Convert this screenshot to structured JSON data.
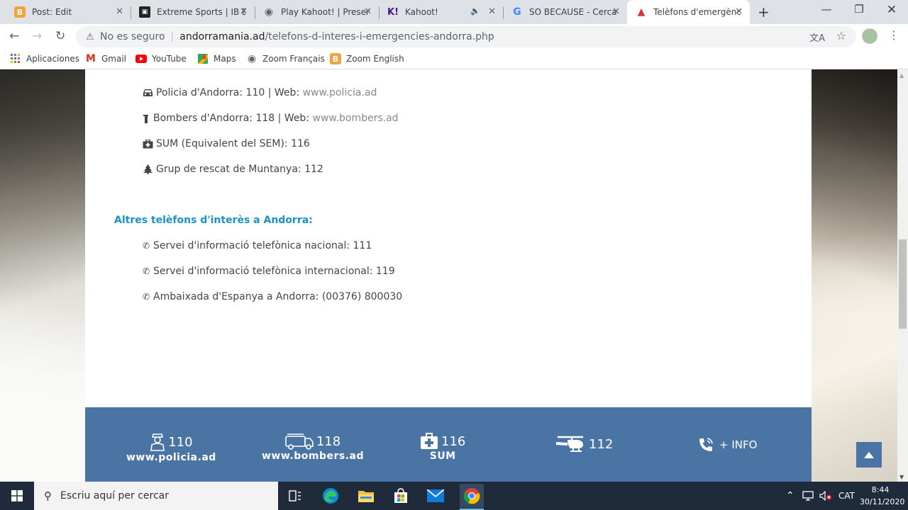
{
  "browser": {
    "tabs": [
      {
        "label": "Post: Edit",
        "favicon": "blogger-icon",
        "active": false
      },
      {
        "label": "Extreme Sports | IB E",
        "favicon": "ib-icon",
        "active": false
      },
      {
        "label": "Play Kahoot! | Presen",
        "favicon": "globe-icon",
        "active": false
      },
      {
        "label": "Kahoot!",
        "favicon": "kahoot-icon",
        "active": false
      },
      {
        "label": "SO BECAUSE - Cerca",
        "favicon": "google-icon",
        "active": false
      },
      {
        "label": "Telèfons d'emergènc",
        "favicon": "andorramania-icon",
        "active": true
      }
    ],
    "new_tab": "+",
    "address": {
      "security_label": "No es seguro",
      "domain": "andorramania.ad",
      "path": "/telefons-d-interes-i-emergencies-andorra.php"
    },
    "bookmarks": [
      {
        "label": "Aplicaciones",
        "icon": "apps-grid-icon"
      },
      {
        "label": "Gmail",
        "icon": "gmail-icon"
      },
      {
        "label": "YouTube",
        "icon": "youtube-icon"
      },
      {
        "label": "Maps",
        "icon": "maps-icon"
      },
      {
        "label": "Zoom Français",
        "icon": "globe-icon"
      },
      {
        "label": "Zoom English",
        "icon": "blogger-icon"
      }
    ]
  },
  "page": {
    "emergency_rows": [
      {
        "icon": "car-icon",
        "text": "Policia d'Andorra: 110 | Web: ",
        "link": "www.policia.ad"
      },
      {
        "icon": "fire-extinguisher-icon",
        "text": "Bombers d'Andorra: 118 | Web: ",
        "link": "www.bombers.ad"
      },
      {
        "icon": "medkit-icon",
        "text": "SUM (Equivalent del SEM): 116",
        "link": ""
      },
      {
        "icon": "tree-icon",
        "text": "Grup de rescat de Muntanya: 112",
        "link": ""
      }
    ],
    "interest_heading": "Altres telèfons d'interès a Andorra:",
    "interest_rows": [
      {
        "icon": "phone-icon",
        "text": "Servei d'informació telefònica nacional: 111"
      },
      {
        "icon": "phone-icon",
        "text": "Servei d'informació telefònica internacional: 119"
      },
      {
        "icon": "phone-icon",
        "text": "Ambaixada d'Espanya a Andorra: (00376) 800030"
      }
    ],
    "footer": [
      {
        "icon": "police-officer-icon",
        "number": "110",
        "sub": "www.policia.ad"
      },
      {
        "icon": "fire-truck-icon",
        "number": "118",
        "sub": "www.bombers.ad"
      },
      {
        "icon": "medkit-icon",
        "number": "116",
        "sub": "SUM"
      },
      {
        "icon": "helicopter-icon",
        "number": "112",
        "sub": ""
      },
      {
        "icon": "phone-ringing-icon",
        "number": "+ INFO",
        "sub": ""
      }
    ]
  },
  "taskbar": {
    "search_placeholder": "Escriu aquí per cercar",
    "language": "CAT",
    "time": "8:44",
    "date": "30/11/2020"
  },
  "colors": {
    "accent_heading": "#1a93c4",
    "footer_bg": "#4a74a4",
    "taskbar_bg": "#1f2b3a"
  }
}
